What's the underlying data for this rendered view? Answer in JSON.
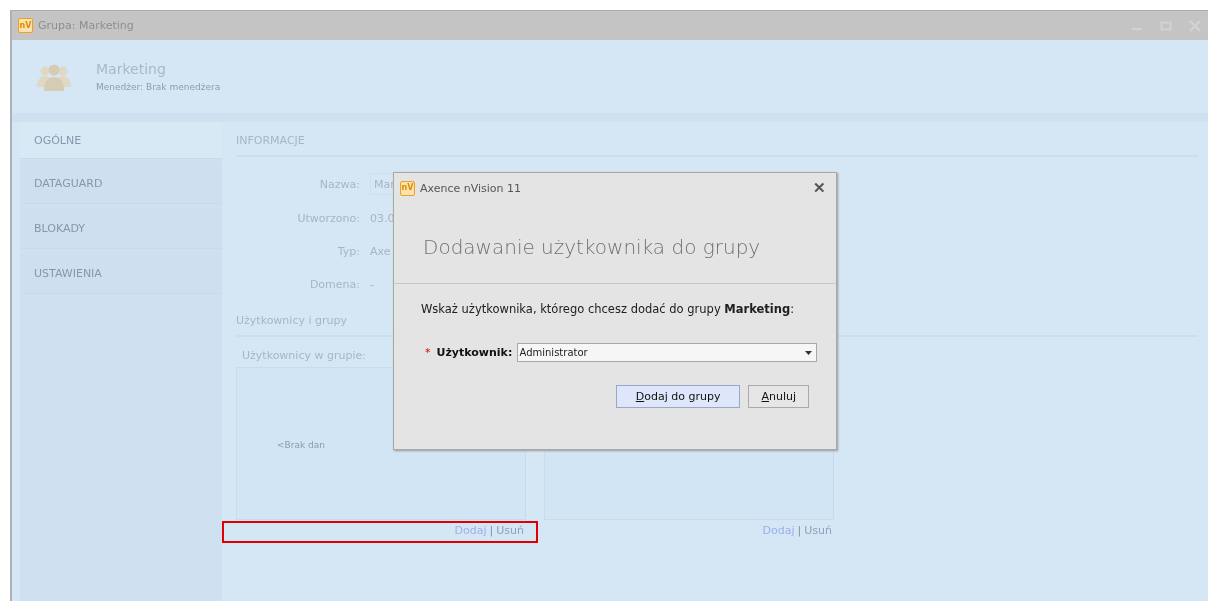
{
  "window": {
    "logo": "nV",
    "title": "Grupa: Marketing"
  },
  "header": {
    "name": "Marketing",
    "subtitle": "Menedżer:  Brak menedżera"
  },
  "sidebar": {
    "items": [
      {
        "label": "OGÓLNE",
        "selected": true
      },
      {
        "label": "DATAGUARD",
        "selected": false
      },
      {
        "label": "BLOKADY",
        "selected": false
      },
      {
        "label": "USTAWIENIA",
        "selected": false
      }
    ]
  },
  "info": {
    "title": "INFORMACJE",
    "fields": [
      {
        "label": "Nazwa:",
        "value": "Mar",
        "kind": "input"
      },
      {
        "label": "Utworzono:",
        "value": "03.0",
        "kind": "text"
      },
      {
        "label": "Typ:",
        "value": "Axe",
        "kind": "text"
      },
      {
        "label": "Domena:",
        "value": "-",
        "kind": "text"
      }
    ]
  },
  "members": {
    "title": "Użytkownicy i grupy",
    "lists": [
      {
        "label": "Użytkownicy w grupie:",
        "empty_text": "<Brak dan",
        "add": "Dodaj",
        "separator": "|",
        "remove": "Usuń",
        "highlighted": true
      },
      {
        "add": "Dodaj",
        "separator": "|",
        "remove": "Usuń",
        "highlighted": false
      }
    ]
  },
  "dialog": {
    "logo": "nV",
    "title": "Axence nVision 11",
    "close": "✕",
    "heading": "Dodawanie użytkownika do grupy",
    "instruction": "Wskaż użytkownika, którego chcesz dodać do grupy **Marketing**:",
    "field": {
      "required_mark": "*",
      "label": "Użytkownik:",
      "value": "Administrator"
    },
    "buttons": [
      {
        "label": "Dodaj do grupy",
        "default": true
      },
      {
        "label": "Anuluj",
        "default": false
      }
    ]
  }
}
